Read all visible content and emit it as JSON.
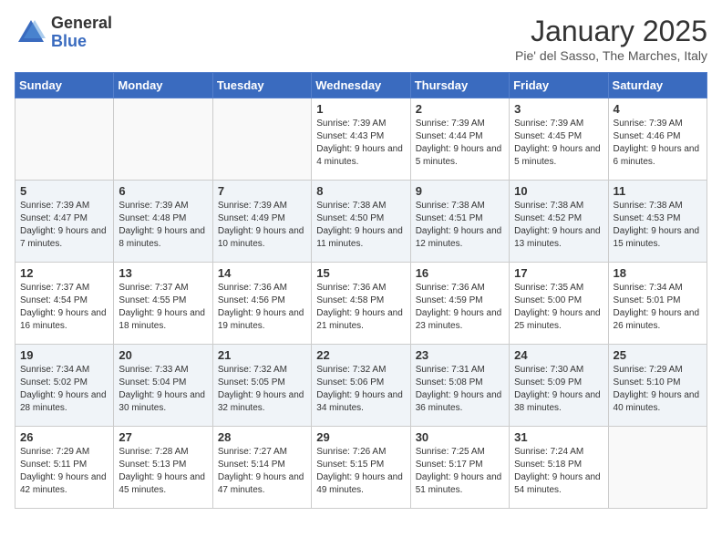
{
  "logo": {
    "general": "General",
    "blue": "Blue"
  },
  "title": "January 2025",
  "location": "Pie' del Sasso, The Marches, Italy",
  "days_of_week": [
    "Sunday",
    "Monday",
    "Tuesday",
    "Wednesday",
    "Thursday",
    "Friday",
    "Saturday"
  ],
  "weeks": [
    {
      "shaded": false,
      "days": [
        {
          "num": "",
          "content": ""
        },
        {
          "num": "",
          "content": ""
        },
        {
          "num": "",
          "content": ""
        },
        {
          "num": "1",
          "content": "Sunrise: 7:39 AM\nSunset: 4:43 PM\nDaylight: 9 hours and 4 minutes."
        },
        {
          "num": "2",
          "content": "Sunrise: 7:39 AM\nSunset: 4:44 PM\nDaylight: 9 hours and 5 minutes."
        },
        {
          "num": "3",
          "content": "Sunrise: 7:39 AM\nSunset: 4:45 PM\nDaylight: 9 hours and 5 minutes."
        },
        {
          "num": "4",
          "content": "Sunrise: 7:39 AM\nSunset: 4:46 PM\nDaylight: 9 hours and 6 minutes."
        }
      ]
    },
    {
      "shaded": true,
      "days": [
        {
          "num": "5",
          "content": "Sunrise: 7:39 AM\nSunset: 4:47 PM\nDaylight: 9 hours and 7 minutes."
        },
        {
          "num": "6",
          "content": "Sunrise: 7:39 AM\nSunset: 4:48 PM\nDaylight: 9 hours and 8 minutes."
        },
        {
          "num": "7",
          "content": "Sunrise: 7:39 AM\nSunset: 4:49 PM\nDaylight: 9 hours and 10 minutes."
        },
        {
          "num": "8",
          "content": "Sunrise: 7:38 AM\nSunset: 4:50 PM\nDaylight: 9 hours and 11 minutes."
        },
        {
          "num": "9",
          "content": "Sunrise: 7:38 AM\nSunset: 4:51 PM\nDaylight: 9 hours and 12 minutes."
        },
        {
          "num": "10",
          "content": "Sunrise: 7:38 AM\nSunset: 4:52 PM\nDaylight: 9 hours and 13 minutes."
        },
        {
          "num": "11",
          "content": "Sunrise: 7:38 AM\nSunset: 4:53 PM\nDaylight: 9 hours and 15 minutes."
        }
      ]
    },
    {
      "shaded": false,
      "days": [
        {
          "num": "12",
          "content": "Sunrise: 7:37 AM\nSunset: 4:54 PM\nDaylight: 9 hours and 16 minutes."
        },
        {
          "num": "13",
          "content": "Sunrise: 7:37 AM\nSunset: 4:55 PM\nDaylight: 9 hours and 18 minutes."
        },
        {
          "num": "14",
          "content": "Sunrise: 7:36 AM\nSunset: 4:56 PM\nDaylight: 9 hours and 19 minutes."
        },
        {
          "num": "15",
          "content": "Sunrise: 7:36 AM\nSunset: 4:58 PM\nDaylight: 9 hours and 21 minutes."
        },
        {
          "num": "16",
          "content": "Sunrise: 7:36 AM\nSunset: 4:59 PM\nDaylight: 9 hours and 23 minutes."
        },
        {
          "num": "17",
          "content": "Sunrise: 7:35 AM\nSunset: 5:00 PM\nDaylight: 9 hours and 25 minutes."
        },
        {
          "num": "18",
          "content": "Sunrise: 7:34 AM\nSunset: 5:01 PM\nDaylight: 9 hours and 26 minutes."
        }
      ]
    },
    {
      "shaded": true,
      "days": [
        {
          "num": "19",
          "content": "Sunrise: 7:34 AM\nSunset: 5:02 PM\nDaylight: 9 hours and 28 minutes."
        },
        {
          "num": "20",
          "content": "Sunrise: 7:33 AM\nSunset: 5:04 PM\nDaylight: 9 hours and 30 minutes."
        },
        {
          "num": "21",
          "content": "Sunrise: 7:32 AM\nSunset: 5:05 PM\nDaylight: 9 hours and 32 minutes."
        },
        {
          "num": "22",
          "content": "Sunrise: 7:32 AM\nSunset: 5:06 PM\nDaylight: 9 hours and 34 minutes."
        },
        {
          "num": "23",
          "content": "Sunrise: 7:31 AM\nSunset: 5:08 PM\nDaylight: 9 hours and 36 minutes."
        },
        {
          "num": "24",
          "content": "Sunrise: 7:30 AM\nSunset: 5:09 PM\nDaylight: 9 hours and 38 minutes."
        },
        {
          "num": "25",
          "content": "Sunrise: 7:29 AM\nSunset: 5:10 PM\nDaylight: 9 hours and 40 minutes."
        }
      ]
    },
    {
      "shaded": false,
      "days": [
        {
          "num": "26",
          "content": "Sunrise: 7:29 AM\nSunset: 5:11 PM\nDaylight: 9 hours and 42 minutes."
        },
        {
          "num": "27",
          "content": "Sunrise: 7:28 AM\nSunset: 5:13 PM\nDaylight: 9 hours and 45 minutes."
        },
        {
          "num": "28",
          "content": "Sunrise: 7:27 AM\nSunset: 5:14 PM\nDaylight: 9 hours and 47 minutes."
        },
        {
          "num": "29",
          "content": "Sunrise: 7:26 AM\nSunset: 5:15 PM\nDaylight: 9 hours and 49 minutes."
        },
        {
          "num": "30",
          "content": "Sunrise: 7:25 AM\nSunset: 5:17 PM\nDaylight: 9 hours and 51 minutes."
        },
        {
          "num": "31",
          "content": "Sunrise: 7:24 AM\nSunset: 5:18 PM\nDaylight: 9 hours and 54 minutes."
        },
        {
          "num": "",
          "content": ""
        }
      ]
    }
  ]
}
